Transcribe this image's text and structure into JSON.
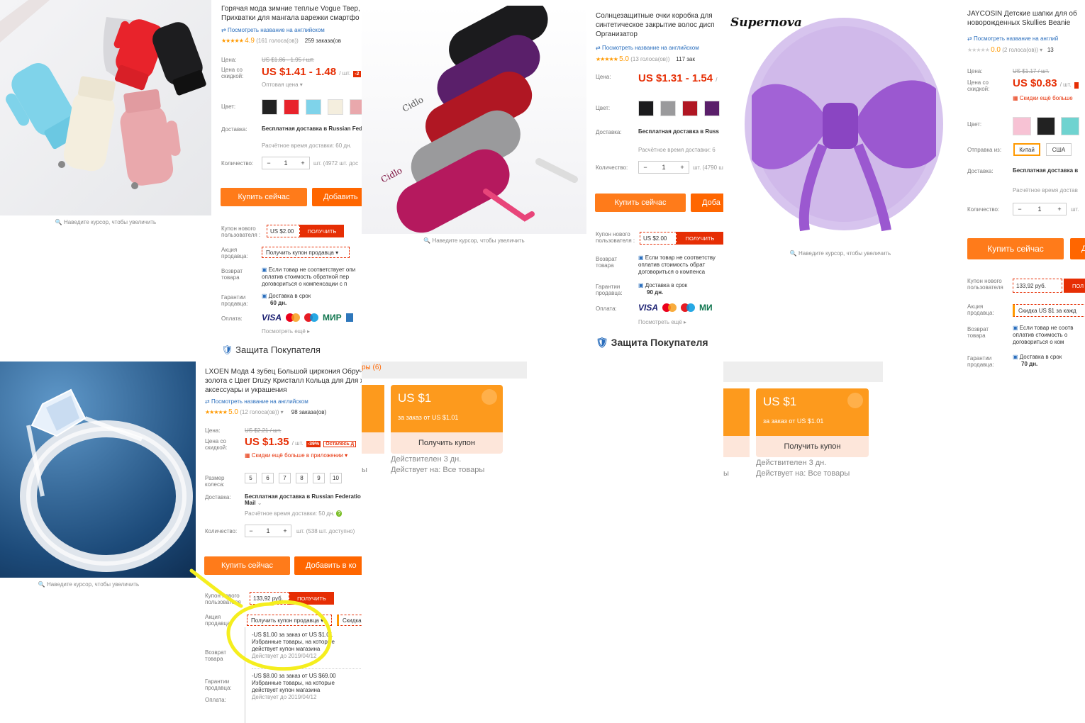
{
  "gloves": {
    "title_line1": "Горячая мода зимние теплые Vogue Твер,",
    "title_line2": "Прихватки для мангала варежки смартфо",
    "english_link": "Посмотреть название на английском",
    "rating": "4.9",
    "votes": "(161 голоса(ов))",
    "orders": "259 заказа(ов",
    "price_label": "Цена:",
    "old_price": "US $1.86 - 1.95 / шт.",
    "discount_label": "Цена со скидкой:",
    "price": "US $1.41 - 1.48",
    "per_unit": "/ шт.",
    "wholesale": "Оптовая цена ▾",
    "color_label": "Цвет:",
    "delivery_label": "Доставка:",
    "delivery": "Бесплатная доставка в Russian Fed",
    "delivery_time": "Расчётное время доставки: 60 дн.",
    "qty_label": "Количество:",
    "qty": "1",
    "stock": "шт. (4972 шт. дос",
    "buy": "Купить сейчас",
    "add": "Добавить",
    "zoom_hint": "Наведите курсор, чтобы увеличить",
    "coupon_label": "Купон нового пользователя :",
    "coupon_amount": "US $2.00",
    "coupon_get": "ПОЛУЧИТЬ",
    "seller_promo_label": "Акция продавца:",
    "seller_coupon": "Получить купон продавца ▾",
    "return_label": "Возврат товара",
    "return_text": "Если товар не соответствует опи оплатив стоимость обратной пер договориться о компенсации с п",
    "guarantee_label": "Гарантии продавца:",
    "guarantee_title": "Доставка в срок",
    "guarantee_days": "60 дн.",
    "payment_label": "Оплата:",
    "see_more": "Посмотреть ещё ▸",
    "protection": "Защита Покупателя"
  },
  "glasses": {
    "title_line1": "Солнцезащитные очки коробка для",
    "title_line2": "синтетическое закрытие волос дисп",
    "title_line3": "Организатор",
    "english_link": "Посмотреть название на английском",
    "rating": "5.0",
    "votes": "(13 голоса(ов))",
    "orders": "117 зак",
    "price_label": "Цена:",
    "price": "US $1.31 - 1.54",
    "per_unit": "/",
    "color_label": "Цвет:",
    "delivery_label": "Доставка:",
    "delivery": "Бесплатная доставка в Russ",
    "delivery_time": "Расчётное время доставки: 6",
    "qty_label": "Количество:",
    "qty": "1",
    "stock": "шт. (4790 ш",
    "buy": "Купить сейчас",
    "add": "Доба",
    "zoom_hint": "Наведите курсор, чтобы увеличить",
    "coupon_label": "Купон нового пользователя :",
    "coupon_amount": "US $2.00",
    "coupon_get": "ПОЛУЧИТЬ",
    "return_label": "Возврат товара",
    "return_text": "Если товар не соответству оплатив стоимость обрат договориться о компенса",
    "guarantee_label": "Гарантии продавца:",
    "guarantee_title": "Доставка в срок",
    "guarantee_days": "90 дн.",
    "payment_label": "Оплата:",
    "see_more": "Посмотреть ещё ▸",
    "protection": "Защита Покупателя"
  },
  "hat": {
    "brand": "Supernova",
    "title_line1": "JAYCOSIN Детские шапки для об",
    "title_line2": "новорожденных Skullies Beanie",
    "english_link": "Посмотреть название на англий",
    "rating": "0.0",
    "votes": "(2 голоса(ов)) ▾",
    "orders": "13",
    "price_label": "Цена:",
    "old_price": "US $1.17 / шт.",
    "discount_label": "Цена со скидкой:",
    "price": "US $0.83",
    "per_unit": "/ шт.",
    "app_discount": "Скидки ещё больше",
    "color_label": "Цвет:",
    "ship_from_label": "Отправка из:",
    "ship_china": "Китай",
    "ship_usa": "США",
    "delivery_label": "Доставка:",
    "delivery": "Бесплатная доставка в",
    "delivery_time": "Расчётное время достав",
    "qty_label": "Количество:",
    "qty": "1",
    "stock": "шт.",
    "buy": "Купить сейчас",
    "add": "Д",
    "zoom_hint": "Наведите курсор, чтобы увеличить",
    "coupon_label": "Купон нового пользователя",
    "coupon_amount": "133,92 руб.",
    "coupon_get": "ПОЛ",
    "seller_promo_label": "Акция продавца:",
    "seller_discount": "Скидка US $1 за кажд",
    "return_label": "Возврат товара",
    "return_text": "Если товар не соотв оплатив стоимость о договориться о ком",
    "guarantee_label": "Гарантии продавца:",
    "guarantee_title": "Доставка в срок",
    "guarantee_days": "70 дн."
  },
  "ring": {
    "title_line1": "LXOEN Мода 4 зубец Большой циркония Обруч",
    "title_line2": "золота с Цвет Druzy Кристалл Кольца для Для ж",
    "title_line3": "аксессуары и украшения",
    "english_link": "Посмотреть название на английском",
    "rating": "5.0",
    "votes": "(12 голоса(ов)) ▾",
    "orders": "98 заказа(ов)",
    "price_label": "Цена:",
    "old_price": "US $2.21 / шт.",
    "discount_label": "Цена со скидкой:",
    "price": "US $1.35",
    "per_unit": "/ шт.",
    "discount_tag": "-39%",
    "remaining_tag": "Осталось д",
    "app_discount": "Скидки ещё больше в приложении ▾",
    "size_label": "Размер колеса:",
    "sizes": [
      "5",
      "6",
      "7",
      "8",
      "9",
      "10"
    ],
    "delivery_label": "Доставка:",
    "delivery_line1": "Бесплатная доставка в Russian Federatio",
    "delivery_line2": "Mail",
    "delivery_time": "Расчётное время доставки: 50 дн.",
    "qty_label": "Количество:",
    "qty": "1",
    "stock": "шт. (538 шт. доступно)",
    "buy": "Купить сейчас",
    "add": "Добавить в ко",
    "zoom_hint": "Наведите курсор, чтобы увеличить",
    "coupon_label": "Купон нового пользователя",
    "coupon_amount": "133,92 руб.",
    "coupon_get": "ПОЛУЧИТЬ",
    "seller_promo_label": "Акция продавца:",
    "seller_coupon": "Получить купон продавца ▾",
    "seller_discount": "Скидка",
    "return_label": "Возврат товара",
    "guarantee_label": "Гарантии продавца:",
    "payment_label": "Оплата:",
    "dropdown": [
      {
        "line1": "-US $1.00 за заказ от US $1.01",
        "line2": "Избранные товары, на которые",
        "line3": "действует купон магазина",
        "valid": "Действует до 2019/04/12"
      },
      {
        "line1": "-US $8.00 за заказ от US $69.00",
        "line2": "Избранные товары, на которые",
        "line3": "действует купон магазина",
        "valid": "Действует до 2019/04/12"
      }
    ]
  },
  "coupons_left": {
    "header": "ры (6)",
    "amount": "US $1",
    "min_order": "за заказ от US $1.01",
    "get": "Получить купон",
    "valid": "Действителен 3 дн.",
    "applies": "Действует на: Все товары",
    "edge_text": "ы"
  },
  "coupons_right": {
    "amount": "US $1",
    "min_order": "за заказ от US $1.01",
    "get": "Получить купон",
    "valid": "Действителен 3 дн.",
    "applies": "Действует на: Все товары",
    "edge_text": "ы"
  },
  "colors": {
    "accent_orange": "#ff7b1a",
    "price_red": "#e62e04",
    "coupon_orange": "#fd9a1d",
    "highlight_yellow": "#f5ee1e"
  }
}
